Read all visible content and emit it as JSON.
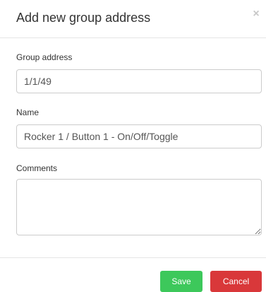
{
  "modal": {
    "title": "Add new group address",
    "close_label": "×"
  },
  "form": {
    "group_address": {
      "label": "Group address",
      "value": "1/1/49"
    },
    "name": {
      "label": "Name",
      "value": "Rocker 1 / Button 1 - On/Off/Toggle"
    },
    "comments": {
      "label": "Comments",
      "value": ""
    }
  },
  "footer": {
    "save_label": "Save",
    "cancel_label": "Cancel"
  },
  "colors": {
    "save": "#3dc85b",
    "cancel": "#d9383a"
  }
}
